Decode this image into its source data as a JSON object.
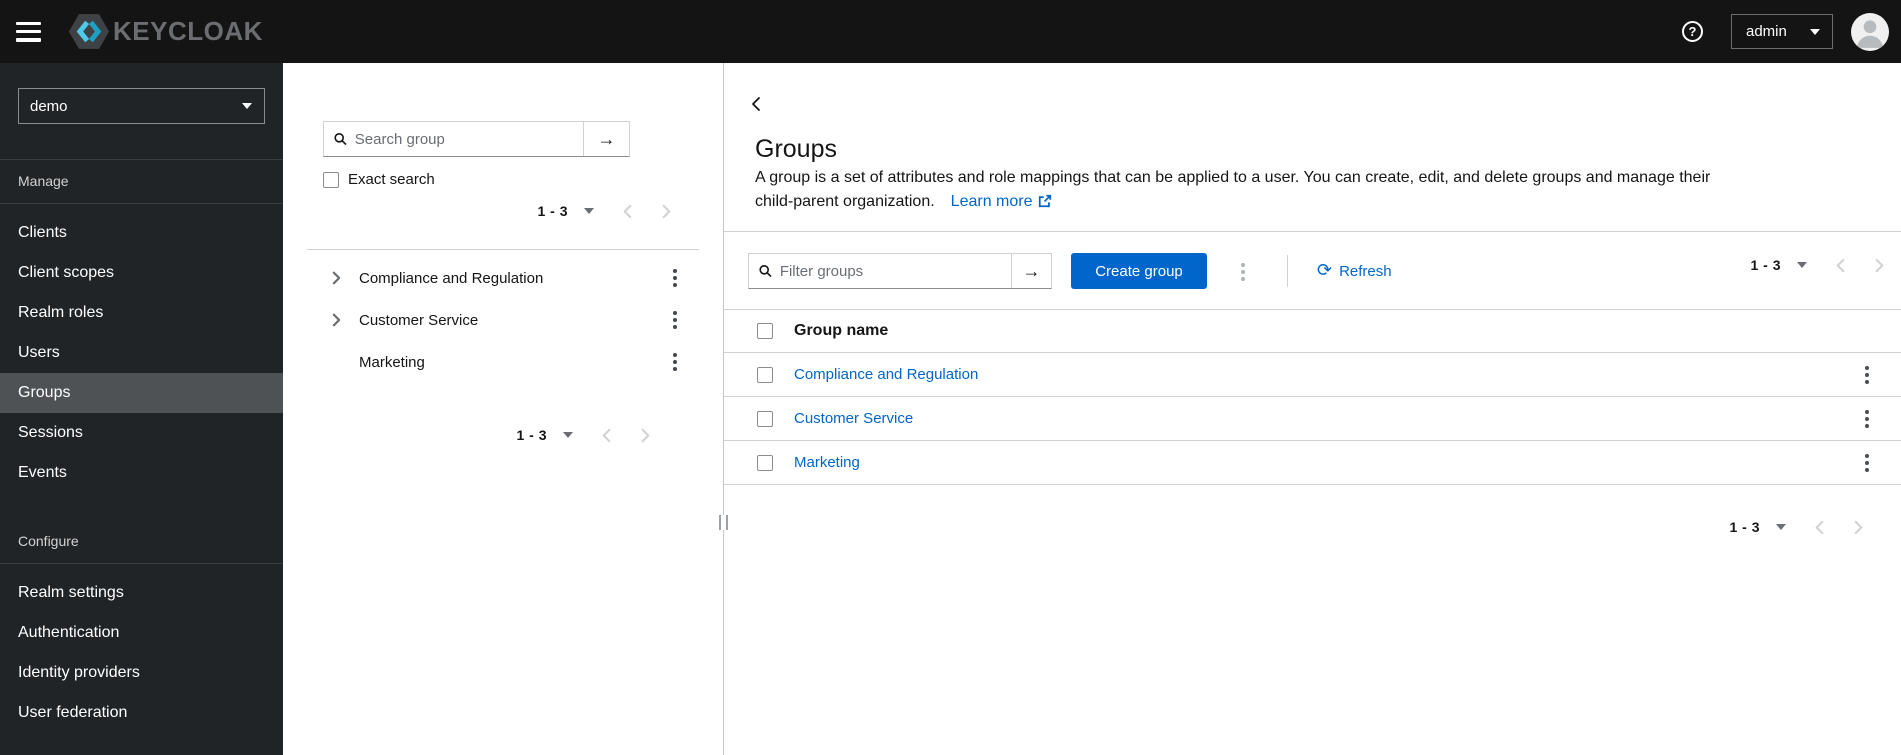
{
  "masthead": {
    "brand": "KEYCLOAK",
    "help_glyph": "?",
    "user": "admin"
  },
  "sidebar": {
    "realm_selector": {
      "value": "demo"
    },
    "sections": [
      {
        "label": "Manage",
        "items": [
          {
            "label": "Clients"
          },
          {
            "label": "Client scopes"
          },
          {
            "label": "Realm roles"
          },
          {
            "label": "Users"
          },
          {
            "label": "Groups",
            "current": true
          },
          {
            "label": "Sessions"
          },
          {
            "label": "Events"
          }
        ]
      },
      {
        "label": "Configure",
        "items": [
          {
            "label": "Realm settings"
          },
          {
            "label": "Authentication"
          },
          {
            "label": "Identity providers"
          },
          {
            "label": "User federation"
          }
        ]
      }
    ]
  },
  "tree_panel": {
    "search_placeholder": "Search group",
    "exact_search_label": "Exact search",
    "pagination_top": "1 - 3",
    "pagination_bottom": "1 - 3",
    "items": [
      {
        "label": "Compliance and Regulation",
        "expandable": true
      },
      {
        "label": "Customer Service",
        "expandable": true
      },
      {
        "label": "Marketing",
        "expandable": false
      }
    ]
  },
  "main": {
    "title": "Groups",
    "description_line1": "A group is a set of attributes and role mappings that can be applied to a user. You can create, edit, and delete groups and manage their",
    "description_line2": "child-parent organization.",
    "learn_more_label": "Learn more",
    "toolbar": {
      "filter_placeholder": "Filter groups",
      "create_button": "Create group",
      "refresh_label": "Refresh",
      "pagination": "1 - 3"
    },
    "table": {
      "header": "Group name",
      "rows": [
        {
          "name": "Compliance and Regulation"
        },
        {
          "name": "Customer Service"
        },
        {
          "name": "Marketing"
        }
      ]
    },
    "pagination_bottom": "1 - 3"
  },
  "icons": {
    "arrow_right": "→",
    "refresh": "⟳"
  },
  "colors": {
    "primary": "#0066cc",
    "link": "#0066cc",
    "masthead_bg": "#141414",
    "sidebar_bg": "#212427",
    "sidebar_current_bg": "#4f5255",
    "border": "#d2d2d2",
    "logo_cyan_light": "#4dc9e9",
    "logo_cyan_dark": "#1e9fc4"
  }
}
